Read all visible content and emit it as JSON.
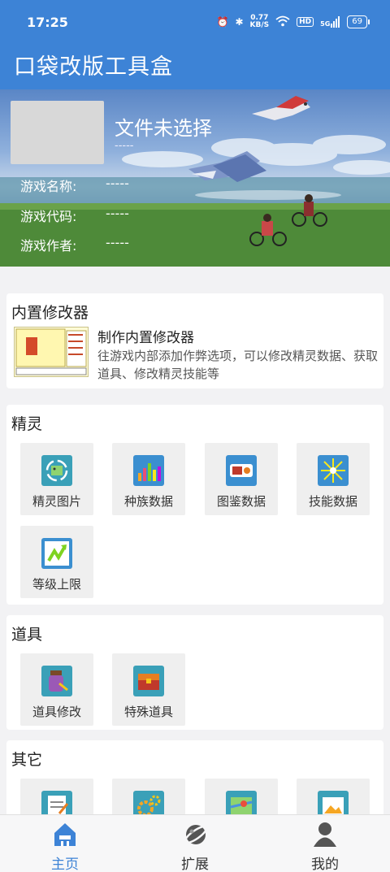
{
  "status_bar": {
    "time": "17:25",
    "net_speed_value": "0.77",
    "net_speed_unit": "KB/S",
    "hd": "HD",
    "signal": "5G",
    "battery": "69"
  },
  "app": {
    "title": "口袋改版工具盒"
  },
  "rom_info": {
    "file_title": "文件未选择",
    "file_sub": "-----",
    "rows": [
      {
        "label": "游戏名称:",
        "value": "-----"
      },
      {
        "label": "游戏代码:",
        "value": "-----"
      },
      {
        "label": "游戏作者:",
        "value": "-----"
      }
    ]
  },
  "sections": {
    "builtin": {
      "title": "内置修改器",
      "feature_title": "制作内置修改器",
      "feature_desc": "往游戏内部添加作弊选项，可以修改精灵数据、获取道具、修改精灵技能等"
    },
    "pokemon": {
      "title": "精灵",
      "tiles": [
        {
          "label": "精灵图片",
          "icon": "pokemon-image-icon",
          "color": "#3aa0b8"
        },
        {
          "label": "种族数据",
          "icon": "bar-chart-icon",
          "color": "#3b8fd0"
        },
        {
          "label": "图鉴数据",
          "icon": "pokedex-icon",
          "color": "#3b8fd0"
        },
        {
          "label": "技能数据",
          "icon": "skill-burst-icon",
          "color": "#3b8fd0"
        },
        {
          "label": "等级上限",
          "icon": "level-up-icon",
          "color": "#3b8fd0"
        }
      ]
    },
    "items": {
      "title": "道具",
      "tiles": [
        {
          "label": "道具修改",
          "icon": "potion-icon",
          "color": "#3aa0b8"
        },
        {
          "label": "特殊道具",
          "icon": "treasure-chest-icon",
          "color": "#3aa0b8"
        }
      ]
    },
    "other": {
      "title": "其它",
      "tiles": [
        {
          "label": "",
          "icon": "notepad-icon",
          "color": "#3aa0b8"
        },
        {
          "label": "",
          "icon": "gears-icon",
          "color": "#3aa0b8"
        },
        {
          "label": "",
          "icon": "map-icon",
          "color": "#3aa0b8"
        },
        {
          "label": "",
          "icon": "picture-icon",
          "color": "#3aa0b8"
        }
      ]
    }
  },
  "bottom_nav": [
    {
      "label": "主页",
      "icon": "home-icon",
      "active": true
    },
    {
      "label": "扩展",
      "icon": "planet-icon",
      "active": false
    },
    {
      "label": "我的",
      "icon": "user-icon",
      "active": false
    }
  ],
  "colors": {
    "primary": "#3d83d6",
    "card_bg": "#ffffff",
    "page_bg": "#f2f2f4"
  }
}
